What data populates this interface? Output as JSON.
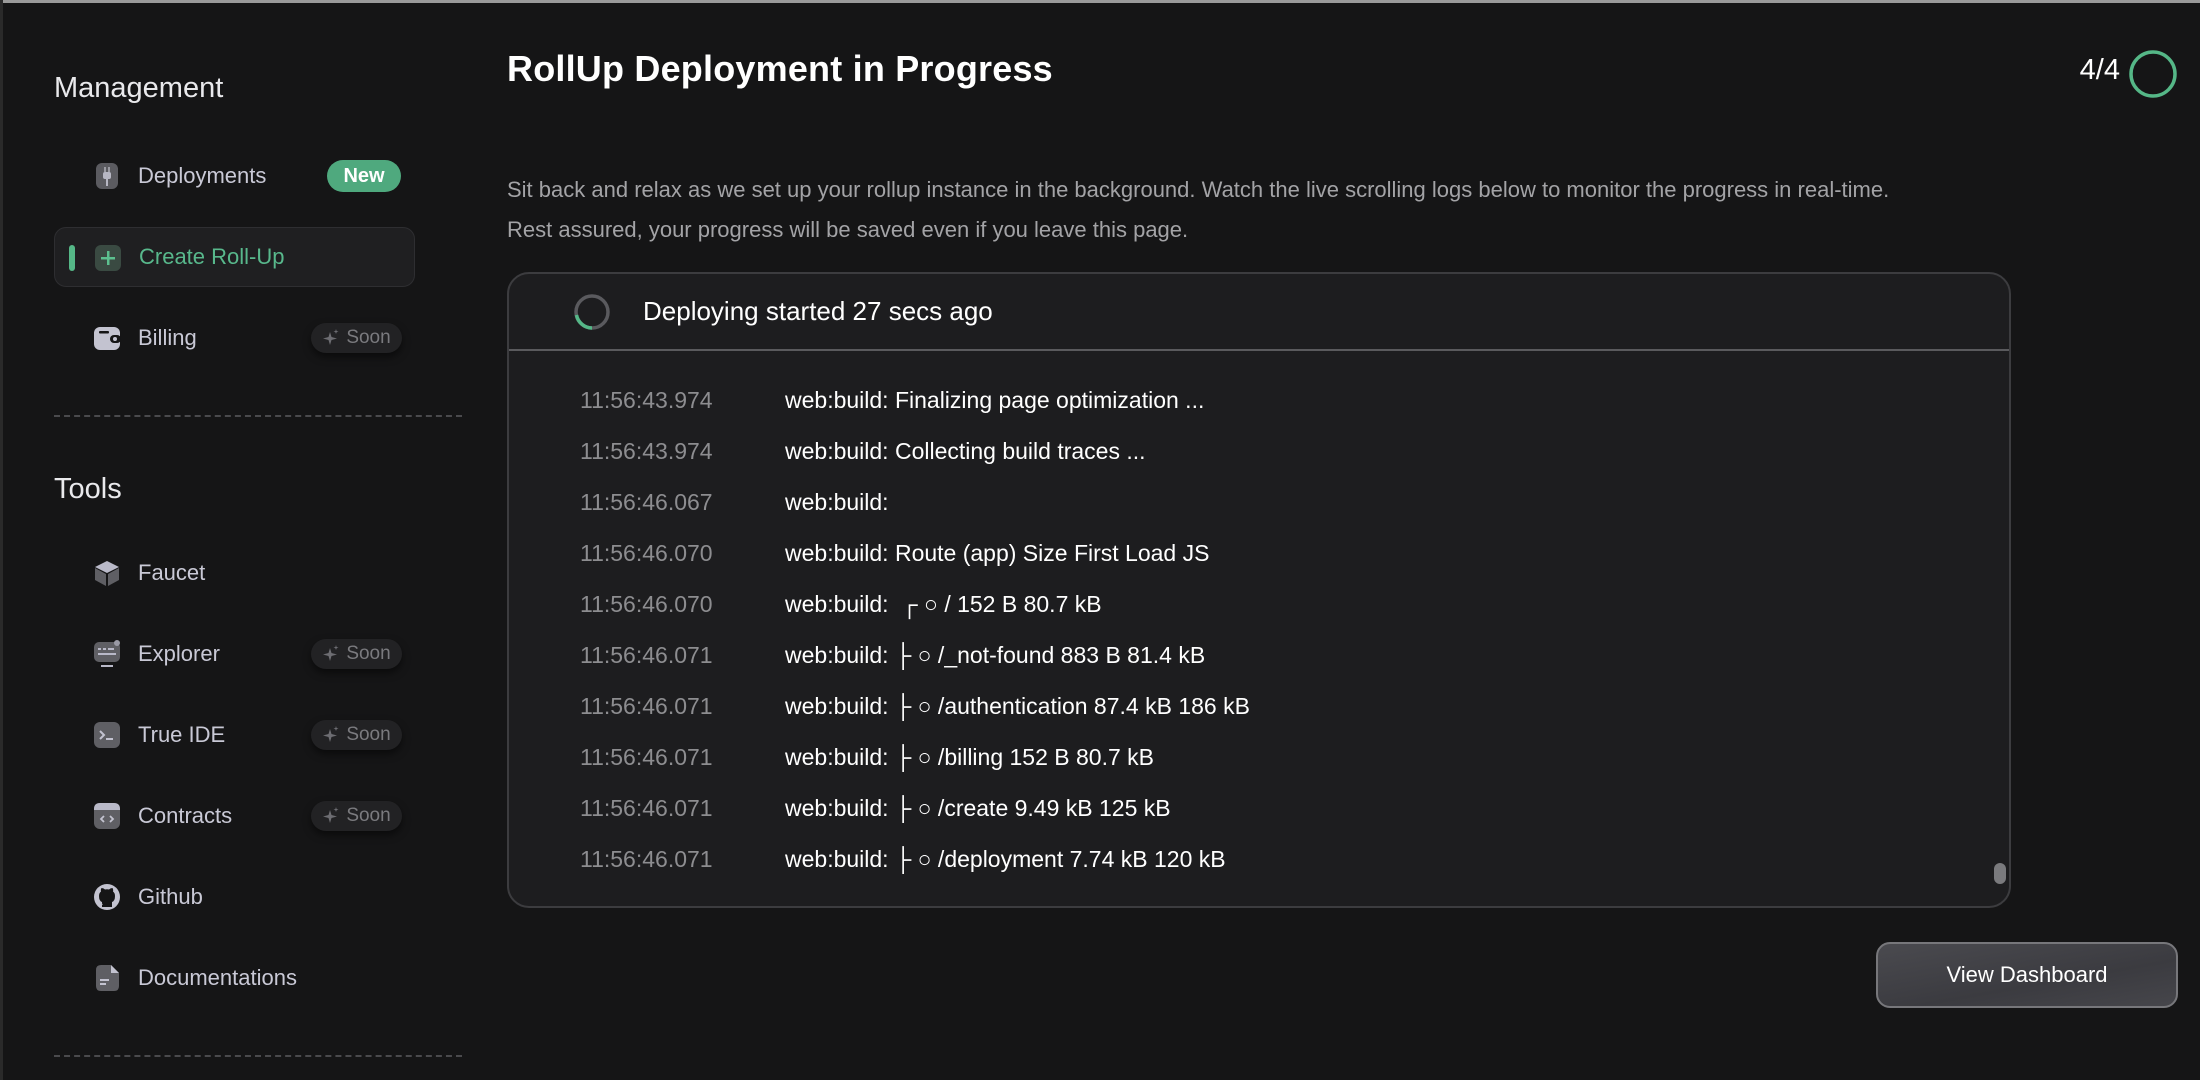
{
  "sidebar": {
    "sections": [
      {
        "heading": "Management",
        "items": [
          {
            "label": "Deployments",
            "icon": "plug-icon",
            "badge": "New",
            "active": false
          },
          {
            "label": "Create Roll-Up",
            "icon": "plus-square-icon",
            "badge": null,
            "active": true
          },
          {
            "label": "Billing",
            "icon": "wallet-icon",
            "badge": "Soon",
            "active": false
          }
        ]
      },
      {
        "heading": "Tools",
        "items": [
          {
            "label": "Faucet",
            "icon": "cube-icon",
            "badge": null
          },
          {
            "label": "Explorer",
            "icon": "explorer-monitor-icon",
            "badge": "Soon"
          },
          {
            "label": "True IDE",
            "icon": "terminal-icon",
            "badge": "Soon"
          },
          {
            "label": "Contracts",
            "icon": "code-window-icon",
            "badge": "Soon"
          },
          {
            "label": "Github",
            "icon": "github-icon",
            "badge": null
          },
          {
            "label": "Documentations",
            "icon": "document-icon",
            "badge": null
          }
        ]
      }
    ]
  },
  "main": {
    "title": "RollUp Deployment in Progress",
    "step": {
      "label": "4/4",
      "current": 4,
      "total": 4
    },
    "description_line1": "Sit back and relax as we set up your rollup instance in the background. Watch the live scrolling logs below to monitor the progress in real-time.",
    "description_line2": "Rest assured, your progress will be saved even if you leave this page.",
    "log_panel": {
      "status": "Deploying started 27 secs ago",
      "lines": [
        {
          "time": "11:56:43.974",
          "message": "web:build: Finalizing page optimization ..."
        },
        {
          "time": "11:56:43.974",
          "message": "web:build: Collecting build traces ..."
        },
        {
          "time": "11:56:46.067",
          "message": "web:build:"
        },
        {
          "time": "11:56:46.070",
          "message": "web:build: Route (app) Size First Load JS"
        },
        {
          "time": "11:56:46.070",
          "message": "web:build:  ┌ ○ / 152 B 80.7 kB"
        },
        {
          "time": "11:56:46.071",
          "message": "web:build: ├ ○ /_not-found 883 B 81.4 kB"
        },
        {
          "time": "11:56:46.071",
          "message": "web:build: ├ ○ /authentication 87.4 kB 186 kB"
        },
        {
          "time": "11:56:46.071",
          "message": "web:build: ├ ○ /billing 152 B 80.7 kB"
        },
        {
          "time": "11:56:46.071",
          "message": "web:build: ├ ○ /create 9.49 kB 125 kB"
        },
        {
          "time": "11:56:46.071",
          "message": "web:build: ├ ○ /deployment 7.74 kB 120 kB"
        }
      ]
    },
    "view_dashboard_label": "View Dashboard"
  },
  "colors": {
    "accent": "#55b787",
    "background": "#151516",
    "panel": "#1d1d1f"
  }
}
